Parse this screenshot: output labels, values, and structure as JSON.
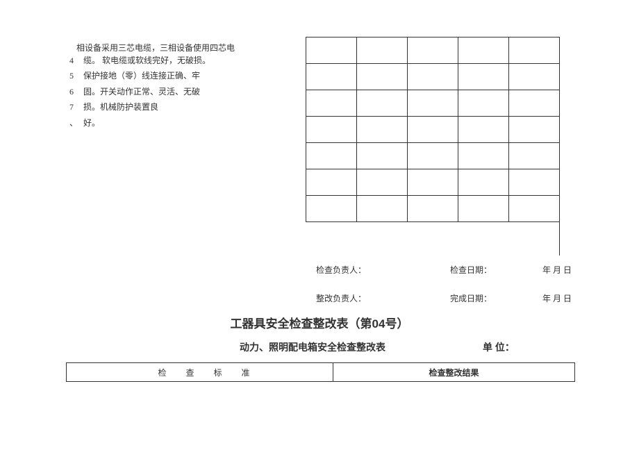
{
  "top_fragment": "相设备采用三芯电缆，三相设备使用四芯电",
  "items": [
    {
      "num": "4",
      "text": "缆。 软电缆或软线完好，无破损。"
    },
    {
      "num": "5",
      "text": "保护接地（零）线连接正确、牢"
    },
    {
      "num": "6",
      "text": "固。开关动作正常、灵活、无破"
    },
    {
      "num": "7",
      "text": "损。机械防护装置良"
    },
    {
      "num": "、",
      "text": "好。"
    }
  ],
  "sig": {
    "inspector_label": "检查负责人：",
    "inspect_date_label": "检查日期：",
    "rectifier_label": "整改负责人：",
    "complete_date_label": "完成日期：",
    "date_fmt": "年 月 日"
  },
  "form": {
    "title": "工器具安全检查整改表（第04号）",
    "subtitle": "动力、照明配电箱安全检查整改表",
    "unit_label": "单 位：",
    "col1": "检查标准",
    "col2": "检查整改结果"
  }
}
